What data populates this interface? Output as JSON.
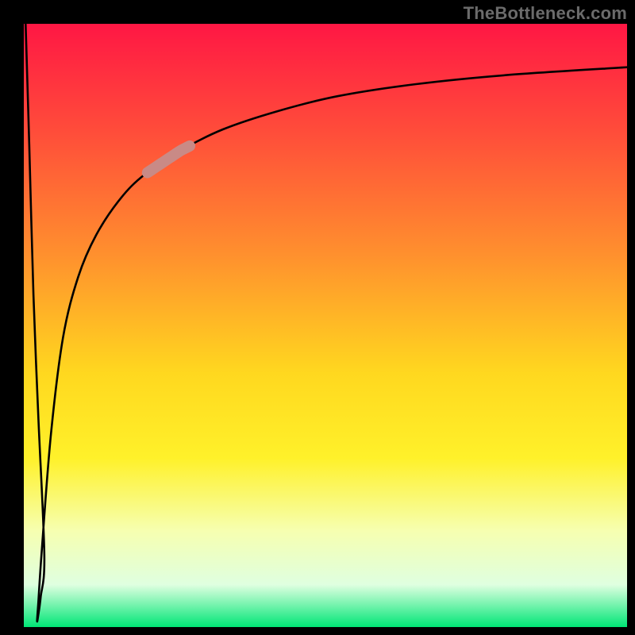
{
  "watermark": "TheBottleneck.com",
  "chart_data": {
    "type": "line",
    "title": "",
    "xlabel": "",
    "ylabel": "",
    "xlim": [
      0,
      100
    ],
    "ylim": [
      0,
      100
    ],
    "grid": false,
    "axes_visible": false,
    "background_gradient": {
      "stops": [
        {
          "pct": 0,
          "color": "#ff1744"
        },
        {
          "pct": 18,
          "color": "#ff4d3a"
        },
        {
          "pct": 38,
          "color": "#ff8f2e"
        },
        {
          "pct": 58,
          "color": "#ffd81f"
        },
        {
          "pct": 72,
          "color": "#fff12a"
        },
        {
          "pct": 84,
          "color": "#f6ffb0"
        },
        {
          "pct": 93,
          "color": "#dfffe0"
        },
        {
          "pct": 100,
          "color": "#00e676"
        }
      ]
    },
    "series": [
      {
        "name": "bottleneck-curve",
        "color": "#000000",
        "x": [
          0.3,
          0.9,
          1.6,
          2.4,
          3.4,
          2.8,
          2.4,
          2.2,
          2.4,
          3.0,
          4.5,
          6.5,
          9.0,
          12.0,
          16.0,
          20.0,
          26.0,
          33.0,
          42.0,
          52.0,
          65.0,
          80.0,
          100.0
        ],
        "y": [
          100,
          80,
          55,
          35,
          12,
          5,
          2,
          1,
          4,
          13,
          32,
          48,
          58,
          65,
          71,
          75,
          79,
          82.5,
          85.5,
          88,
          90,
          91.5,
          92.8
        ]
      }
    ],
    "highlight_segment": {
      "series": "bottleneck-curve",
      "x_range": [
        20.5,
        27.5
      ],
      "color": "#c98a86",
      "note": "thick muted-rose segment overlaid on the curve"
    }
  }
}
